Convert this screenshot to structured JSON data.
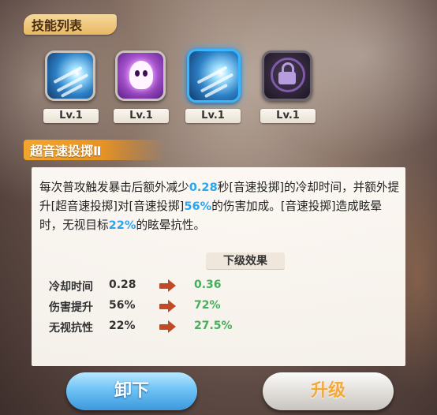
{
  "header": {
    "title": "技能列表"
  },
  "skills": [
    {
      "icon": "wind-slash-icon",
      "level": "Lv.1",
      "selected": false
    },
    {
      "icon": "ghost-icon",
      "level": "Lv.1",
      "selected": false
    },
    {
      "icon": "wind-slash-icon",
      "level": "Lv.1",
      "selected": true
    },
    {
      "icon": "lock-icon",
      "level": "Lv.1",
      "selected": false
    }
  ],
  "skill_detail": {
    "name": "超音速投掷Ⅱ",
    "description_parts": [
      {
        "text": "每次普攻触发暴击后额外减少",
        "highlight": false
      },
      {
        "text": "0.28",
        "highlight": true
      },
      {
        "text": "秒[音速投掷]的冷却时间，并额外提升[超音速投掷]对[音速投掷]",
        "highlight": false
      },
      {
        "text": "56%",
        "highlight": true
      },
      {
        "text": "的伤害加成。[音速投掷]造成眩晕时，无视目标",
        "highlight": false
      },
      {
        "text": "22%",
        "highlight": true
      },
      {
        "text": "的眩晕抗性。",
        "highlight": false
      }
    ],
    "next_level_label": "下级效果",
    "stats": [
      {
        "label": "冷却时间",
        "current": "0.28",
        "next": "0.36"
      },
      {
        "label": "伤害提升",
        "current": "56%",
        "next": "72%"
      },
      {
        "label": "无视抗性",
        "current": "22%",
        "next": "27.5%"
      }
    ]
  },
  "buttons": {
    "unequip": "卸下",
    "upgrade": "升级"
  },
  "colors": {
    "highlight": "#2aa5f0",
    "next_value": "#45b05c",
    "accent_orange": "#e79324",
    "selected_border": "#38b6ff"
  }
}
